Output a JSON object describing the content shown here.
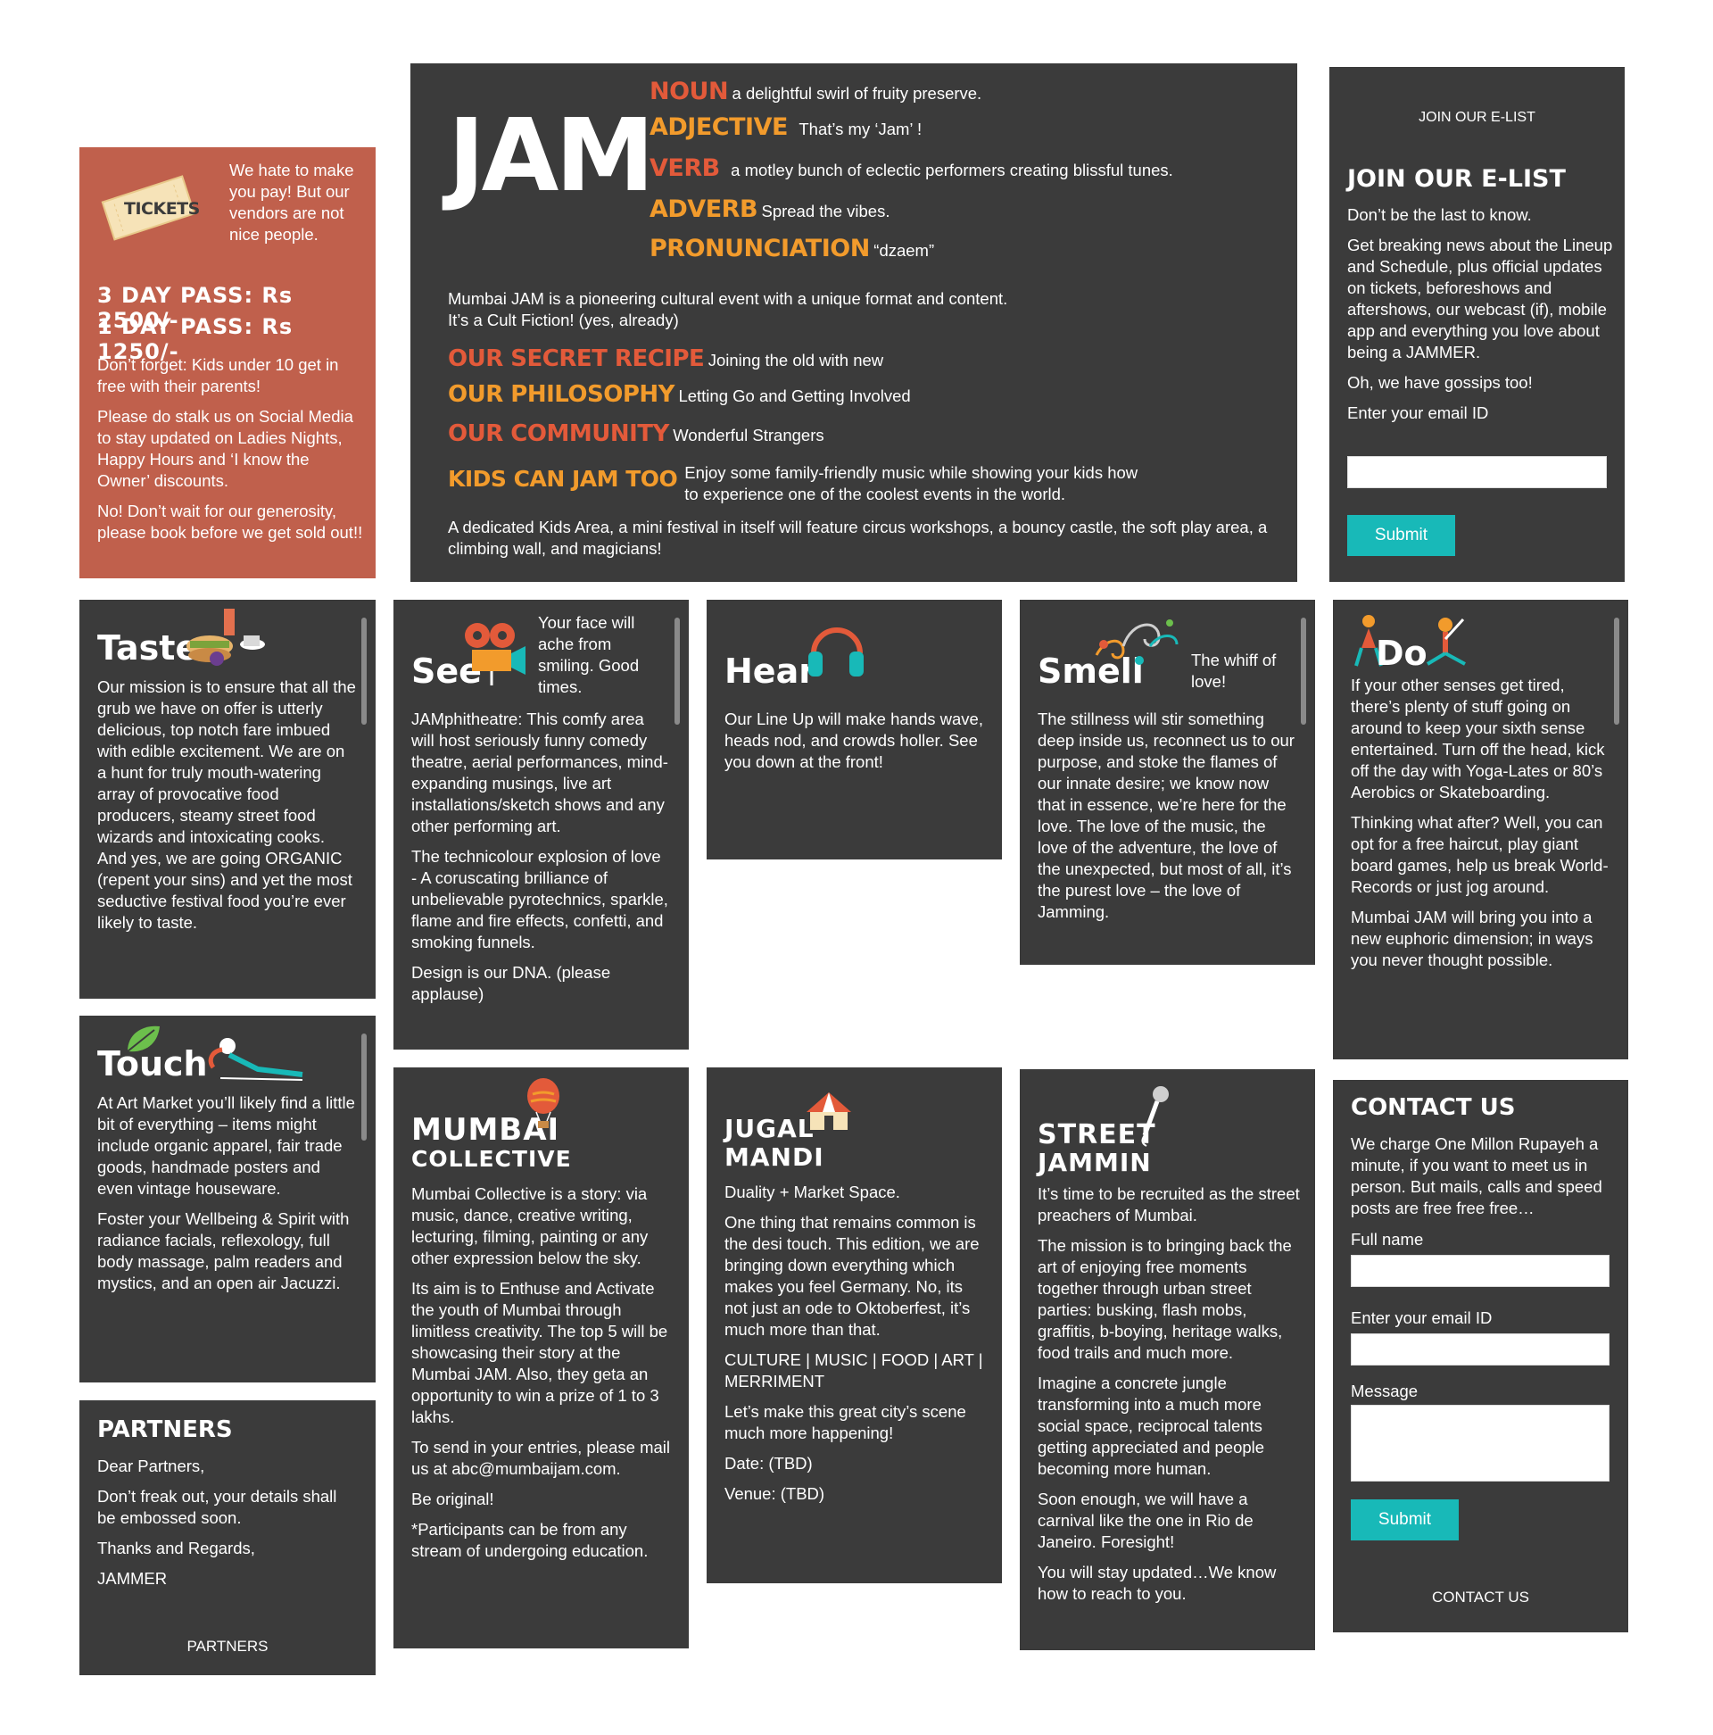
{
  "tickets": {
    "badge": "TICKETS",
    "intro": "We hate to make you pay! But our vendors are not nice people.",
    "pass3": "3 DAY PASS: Rs 2500/-",
    "pass1": "1 DAY PASS: Rs 1250/-",
    "p1": "Don’t forget: Kids under 10 get in free with their parents!",
    "p2": "Please do stalk us on Social Media to stay updated on Ladies Nights, Happy Hours and ‘I know the Owner’ discounts.",
    "p3": "No! Don’t wait for our generosity, please book before we get sold out!!"
  },
  "jam": {
    "logo": "JAM",
    "defs": [
      {
        "term": "NOUN",
        "text": "a delightful swirl of fruity preserve."
      },
      {
        "term": "ADJECTIVE",
        "text": "That’s my ‘Jam’ !"
      },
      {
        "term": "VERB",
        "text": "a motley bunch of eclectic performers creating blissful tunes."
      },
      {
        "term": "ADVERB",
        "text": "Spread the vibes."
      },
      {
        "term": "PRONUNCIATION",
        "text": "“dzaem”"
      }
    ],
    "intro1": "Mumbai JAM is a pioneering cultural event with a unique format and content.",
    "intro2": "It’s a Cult Fiction! (yes, already)",
    "items": [
      {
        "term": "OUR SECRET RECIPE",
        "text": "Joining the old with new"
      },
      {
        "term": "OUR PHILOSOPHY",
        "text": "Letting Go and Getting Involved"
      },
      {
        "term": "OUR COMMUNITY",
        "text": "Wonderful Strangers"
      },
      {
        "term": "KIDS CAN JAM TOO",
        "text": "Enjoy some family-friendly music while showing your kids how to experience one of the coolest events in the world."
      }
    ],
    "kids": "A dedicated Kids Area, a mini festival in itself will feature circus workshops, a bouncy castle, the soft play area, a climbing wall, and magicians!"
  },
  "elist": {
    "top_label": "JOIN OUR E-LIST",
    "heading": "JOIN OUR E-LIST",
    "p1": "Don’t be the last to know.",
    "p2": "Get breaking news about the Lineup and Schedule, plus official updates on tickets, beforeshows and aftershows, our webcast (if), mobile app and everything you love about being a JAMMER.",
    "p3": "Oh, we have gossips too!",
    "email_label": "Enter your email ID",
    "submit": "Submit"
  },
  "taste": {
    "title": "Taste",
    "body": "Our mission is to ensure that all the grub we have on offer is utterly delicious, top notch fare imbued with edible excitement. We are on a hunt for truly mouth-watering array of provocative food producers, steamy street food wizards and intoxicating cooks. And yes, we are going ORGANIC (repent your sins) and yet the most seductive festival food you’re ever likely to taste."
  },
  "see": {
    "title": "See",
    "tagline": "Your face will ache from smiling. Good times.",
    "p1": "JAMphitheatre: This comfy area will host seriously funny comedy theatre, aerial performances, mind-expanding musings, live art installations/sketch shows and any other performing art.",
    "p2": "The technicolour explosion of love - A coruscating brilliance of unbelievable pyrotechnics, sparkle, flame and fire effects, confetti, and smoking funnels.",
    "p3": "Design is our DNA. (please applause)"
  },
  "hear": {
    "title": "Hear",
    "body": "Our Line Up will make hands wave, heads nod, and crowds holler. See you down at the front!"
  },
  "smell": {
    "title": "Smell",
    "tagline": "The whiff of love!",
    "body": "The stillness will stir something deep inside us, reconnect us to our purpose, and stoke the flames of our innate desire; we know now that in essence, we’re here for the love. The love of the music, the love of the adventure, the love of the unexpected, but most of all, it’s the purest love – the love of Jamming."
  },
  "do": {
    "title": "Do",
    "p1": "If your other senses get tired, there’s plenty of stuff going on around to keep your sixth sense entertained. Turn off the head, kick off the day with Yoga-Lates or 80’s Aerobics or Skateboarding.",
    "p2": "Thinking what after? Well, you can opt for a free haircut, play giant board games, help us break World-Records or just jog around.",
    "p3": "Mumbai JAM will bring you into a new euphoric dimension; in ways you never thought possible."
  },
  "touch": {
    "title": "Touch",
    "p1": "At Art Market you’ll likely find a little bit of everything – items might include organic apparel, fair trade goods, handmade posters and even vintage houseware.",
    "p2": "Foster your Wellbeing & Spirit with radiance facials, reflexology, full body massage, palm readers and mystics, and an open air Jacuzzi."
  },
  "collective": {
    "title1": "MUMBAI",
    "title2": "COLLECTIVE",
    "p1": "Mumbai Collective is a story: via music, dance, creative writing, lecturing, filming, painting or any other expression below the sky.",
    "p2": "Its aim is to Enthuse and Activate the youth of Mumbai through limitless creativity. The top 5 will be showcasing their story at the Mumbai JAM. Also, they geta an opportunity to win a prize of 1 to 3 lakhs.",
    "p3": "To send in your entries, please mail us at abc@mumbaijam.com.",
    "p4": "Be original!",
    "p5": "*Participants can be from any stream of undergoing education."
  },
  "jugal": {
    "title1": "JUGAL",
    "title2": "MANDI",
    "p1": "Duality + Market Space.",
    "p2": "One thing that remains common is the desi touch. This edition, we are bringing down everything which makes you feel Germany. No, its not just an ode to Oktoberfest, it’s much more than that.",
    "p3": "CULTURE | MUSIC | FOOD | ART | MERRIMENT",
    "p4": "Let’s make this great city’s scene much more happening!",
    "p5": "Date: (TBD)",
    "p6": "Venue: (TBD)"
  },
  "street": {
    "title1": "STREET",
    "title2": "JAMMIN",
    "p1": "It’s time to be recruited as the street preachers of Mumbai.",
    "p2": "The mission is to bringing back the art of enjoying free moments together through urban street parties: busking, flash mobs, graffitis, b-boying, heritage walks, food trails and much more.",
    "p3": "Imagine a concrete jungle transforming into a much more social space, reciprocal talents getting appreciated and people becoming more human.",
    "p4": "Soon enough, we will have a carnival like the one in Rio de Janeiro. Foresight!",
    "p5": "You will stay updated…We know how to reach to you."
  },
  "partners": {
    "heading": "PARTNERS",
    "p1": "Dear Partners,",
    "p2": "Don’t freak out, your details shall be embossed soon.",
    "p3": "Thanks and Regards,",
    "p4": "JAMMER",
    "footer": "PARTNERS"
  },
  "contact": {
    "heading": "CONTACT US",
    "body": "We charge One Millon Rupayeh a minute, if you want to meet us in person. But mails, calls and speed posts are free free free…",
    "name_label": "Full name",
    "email_label": "Enter your email ID",
    "message_label": "Message",
    "submit": "Submit",
    "footer": "CONTACT US"
  },
  "colors": {
    "tile": "#3b3b3b",
    "tickets": "#c0604c",
    "accent_orange": "#f29b2c",
    "accent_red": "#e35a3a",
    "button": "#18b9b8"
  }
}
